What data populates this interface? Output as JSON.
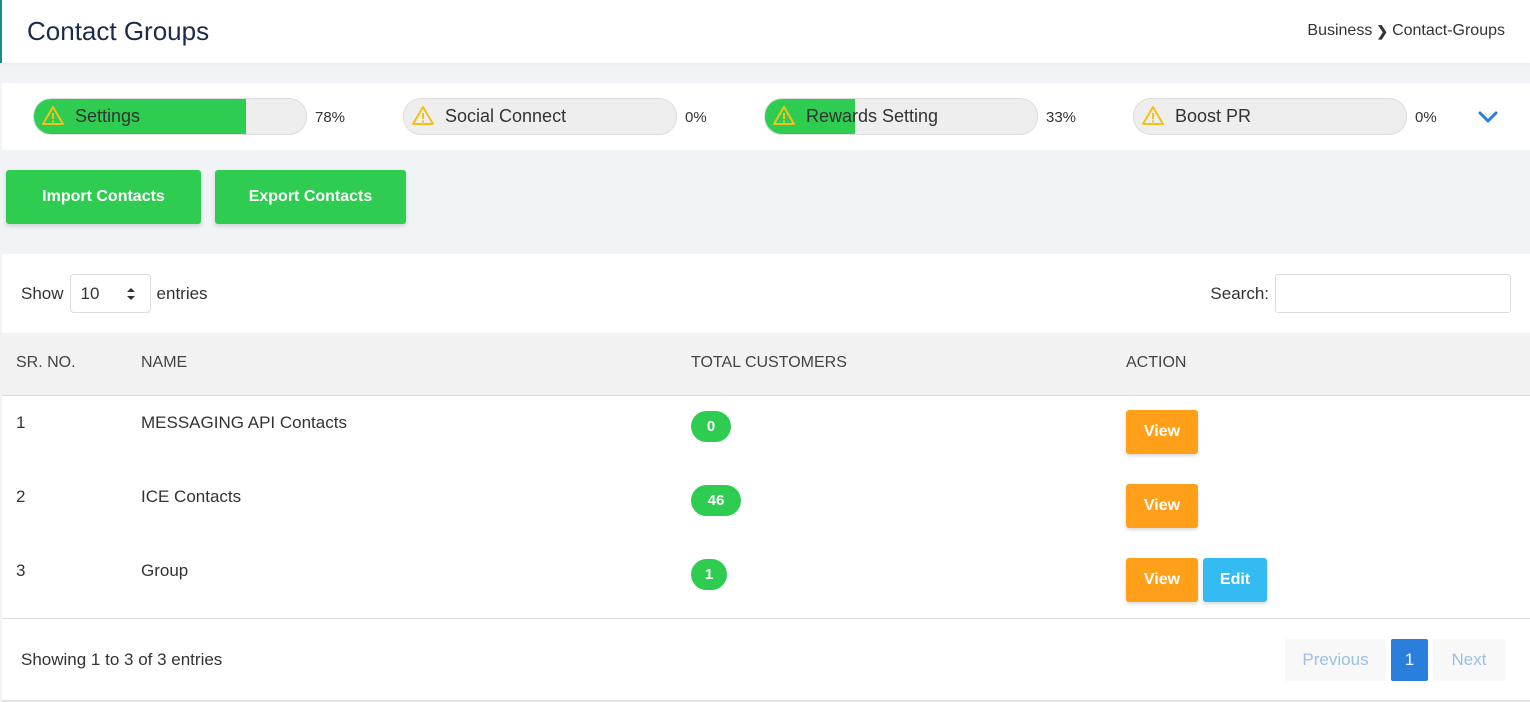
{
  "header": {
    "title": "Contact Groups",
    "breadcrumb": [
      "Business",
      "Contact-Groups"
    ]
  },
  "progress": [
    {
      "label": "Settings",
      "percent_text": "78%",
      "fill": 0.78
    },
    {
      "label": "Social Connect",
      "percent_text": "0%",
      "fill": 0.0
    },
    {
      "label": "Rewards Setting",
      "percent_text": "33%",
      "fill": 0.33
    },
    {
      "label": "Boost PR",
      "percent_text": "0%",
      "fill": 0.0
    }
  ],
  "actions": {
    "import_label": "Import Contacts",
    "export_label": "Export Contacts"
  },
  "table_controls": {
    "show_label": "Show",
    "page_size": "10",
    "entries_label": "entries",
    "search_label": "Search:",
    "search_value": ""
  },
  "table": {
    "columns": [
      "SR. NO.",
      "NAME",
      "TOTAL CUSTOMERS",
      "ACTION"
    ],
    "rows": [
      {
        "sr": "1",
        "name": "MESSAGING API Contacts",
        "total": "0",
        "view_label": "View"
      },
      {
        "sr": "2",
        "name": "ICE Contacts",
        "total": "46",
        "view_label": "View"
      },
      {
        "sr": "3",
        "name": "Group",
        "total": "1",
        "view_label": "View",
        "edit_label": "Edit"
      }
    ]
  },
  "footer": {
    "info": "Showing 1 to 3 of 3 entries",
    "previous_label": "Previous",
    "current_page": "1",
    "next_label": "Next"
  },
  "colors": {
    "green": "#2ecc51",
    "orange": "#ff9f1a",
    "blue": "#33bbf2",
    "primary": "#2a7fdc",
    "warning": "#f2c21b"
  }
}
